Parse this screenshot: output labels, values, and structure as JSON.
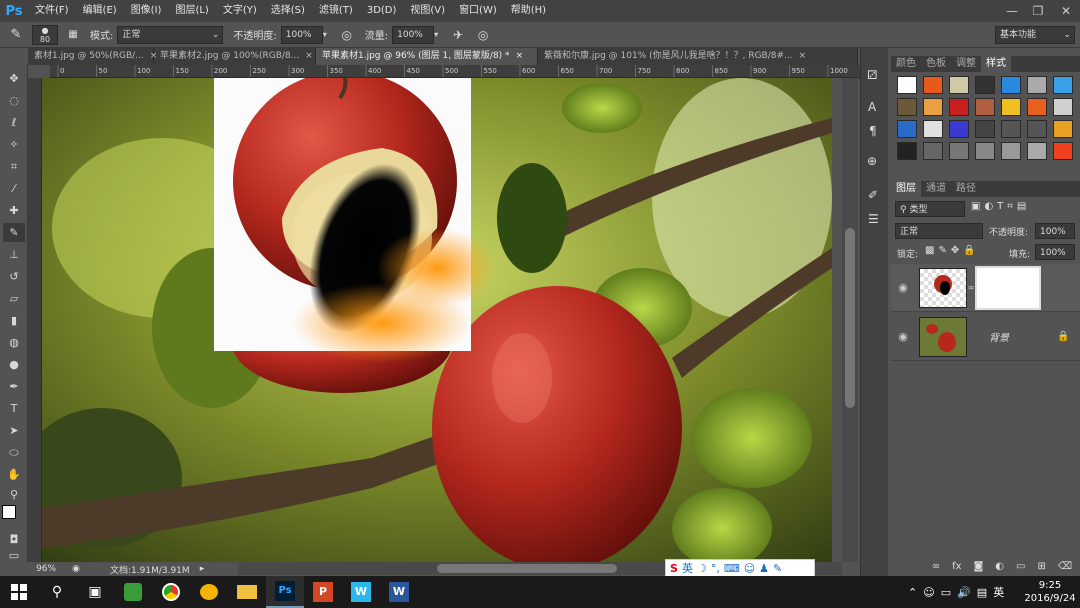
{
  "app": {
    "logo": "Ps"
  },
  "menu": [
    "文件(F)",
    "编辑(E)",
    "图像(I)",
    "图层(L)",
    "文字(Y)",
    "选择(S)",
    "滤镜(T)",
    "3D(D)",
    "视图(V)",
    "窗口(W)",
    "帮助(H)"
  ],
  "window_controls": {
    "minimize": "—",
    "restore": "❐",
    "close": "✕"
  },
  "options": {
    "brush_size": "80",
    "mode_label": "模式:",
    "mode_value": "正常",
    "opacity_label": "不透明度:",
    "opacity_value": "100%",
    "flow_label": "流量:",
    "flow_value": "100%",
    "workspace": "基本功能"
  },
  "tabs": [
    {
      "label": "素材1.jpg @ 50%(RGB/...",
      "close": "×",
      "active": false
    },
    {
      "label": "苹果素材2.jpg @ 100%(RGB/8...",
      "close": "×",
      "active": false
    },
    {
      "label": "苹果素材1.jpg @ 96% (图层 1, 图层蒙版/8) *",
      "close": "×",
      "active": true
    },
    {
      "label": "紫薇和尔康.jpg @ 101% (你是风儿我是啥？！？, RGB/8#...",
      "close": "×",
      "active": false
    }
  ],
  "ruler_ticks": [
    "0",
    "50",
    "100",
    "150",
    "200",
    "250",
    "300",
    "350",
    "400",
    "450",
    "500",
    "550",
    "600",
    "650",
    "700",
    "750",
    "800",
    "850",
    "900",
    "950",
    "1000"
  ],
  "status": {
    "zoom": "96%",
    "doc": "文档:1.91M/3.91M"
  },
  "swatch_panel": {
    "tabs": [
      "颜色",
      "色板",
      "调整",
      "样式"
    ],
    "active": "样式"
  },
  "layers_panel": {
    "tabs": [
      "图层",
      "通道",
      "路径"
    ],
    "filter": "类型",
    "blend": "正常",
    "opacity_label": "不透明度:",
    "opacity_value": "100%",
    "lock_label": "锁定:",
    "fill_label": "填充:",
    "fill_value": "100%",
    "layers": [
      {
        "name": "",
        "has_mask": true
      },
      {
        "name": "背景",
        "locked": true
      }
    ]
  },
  "ime": {
    "lang": "英"
  },
  "taskbar": {
    "time": "9:25",
    "date": "2016/9/24",
    "input_lang": "英"
  },
  "colors": {
    "ps_blue": "#31a8ff",
    "panel_bg": "#535353",
    "menu_bg": "#424242"
  }
}
